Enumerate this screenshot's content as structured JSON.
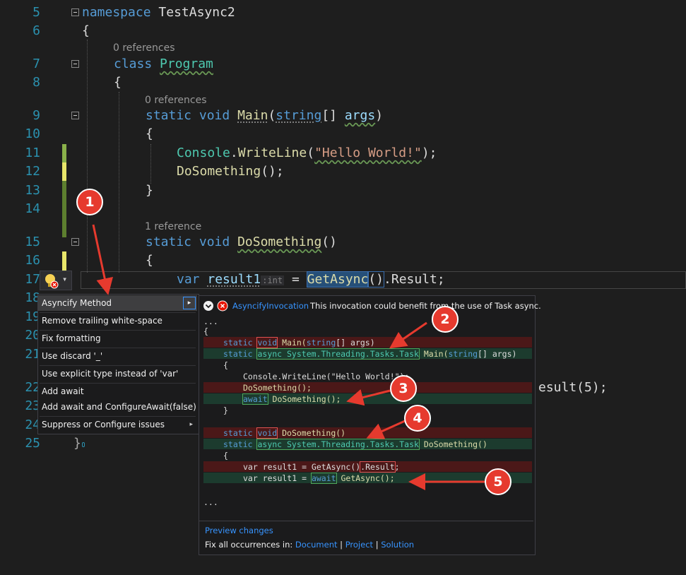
{
  "editor": {
    "line_numbers": [
      "5",
      "6",
      "7",
      "8",
      "9",
      "10",
      "11",
      "12",
      "13",
      "14",
      "15",
      "16",
      "17",
      "18",
      "19",
      "20",
      "21",
      "22",
      "23",
      "24",
      "25"
    ],
    "lines": {
      "l5_kw": "namespace",
      "l5_name": "TestAsync2",
      "l6": "{",
      "l7_kw": "class",
      "l7_name": "Program",
      "l8": "{",
      "l9_static": "static",
      "l9_void": "void",
      "l9_name": "Main",
      "l9_open": "(",
      "l9_type": "string",
      "l9_br": "[]",
      "l9_args": "args",
      "l9_close": ")",
      "l10": "{",
      "l11_cls": "Console",
      "l11_dot": ".",
      "l11_fn": "WriteLine",
      "l11_open": "(",
      "l11_str": "\"Hello World!\"",
      "l11_close": ");",
      "l12_fn": "DoSomething",
      "l12_rest": "();",
      "l13": "}",
      "l15_static": "static",
      "l15_void": "void",
      "l15_name": "DoSomething",
      "l15_rest": "()",
      "l16": "{",
      "l17_var": "var",
      "l17_id": "result1",
      "l17_hint": ":int",
      "l17_eq": " = ",
      "l17_fn": "GetAsync",
      "l17_paren": "()",
      "l17_rest": ".Result;",
      "l22_tail": "esult(5);",
      "l25": "}"
    },
    "refs": {
      "r1": "0 references",
      "r2": "0 references",
      "r3": "1 reference"
    }
  },
  "lightbulb": {
    "icon": "lightbulb-error-icon",
    "dropdown": "▾"
  },
  "menu": {
    "items": [
      "Asyncify Method",
      "Remove trailing white-space",
      "Fix formatting",
      "Use discard '_'",
      "Use explicit type instead of 'var'",
      "Add await",
      "Add await and ConfigureAwait(false)",
      "Suppress or Configure issues"
    ],
    "submenu_arrow": "▸"
  },
  "preview": {
    "header_id": "AsyncifyInvocation",
    "header_msg": "This invocation could benefit from the use of Task async.",
    "dots_top": "...",
    "dots_bottom": "...",
    "lines": {
      "open": "{",
      "m_del_a": "static ",
      "m_del_void": "void",
      "m_del_b": " Main(",
      "m_del_type": "string",
      "m_del_c": "[] args)",
      "m_add_a": "static ",
      "m_add_async": "async System.Threading.Tasks.Task",
      "m_add_b": " Main(",
      "m_add_type": "string",
      "m_add_c": "[] args)",
      "inner_open": "{",
      "console": "Console.WriteLine(\"Hello World!\");",
      "ds_del": "DoSomething();",
      "ds_add_await": "await",
      "ds_add_rest": " DoSomething();",
      "inner_close": "}",
      "d_del_a": "static ",
      "d_del_void": "void",
      "d_del_b": " DoSomething()",
      "d_add_a": "static ",
      "d_add_async": "async System.Threading.Tasks.Task",
      "d_add_b": " DoSomething()",
      "d_open": "{",
      "v_del_a": "var result1 = GetAsync()",
      "v_del_res": ".Result",
      "v_del_b": ";",
      "v_add_a": "var result1 = ",
      "v_add_await": "await",
      "v_add_b": " GetAsync();"
    },
    "preview_changes": "Preview changes",
    "fix_all_label": "Fix all occurrences in:",
    "fix_all_links": [
      "Document",
      "Project",
      "Solution"
    ],
    "sep": "|"
  },
  "badges": [
    "1",
    "2",
    "3",
    "4",
    "5"
  ],
  "colors": {
    "accent": "#3794ff",
    "badge": "#e63a2e",
    "deleted": "#4b1818",
    "added": "#1c3b2e"
  }
}
